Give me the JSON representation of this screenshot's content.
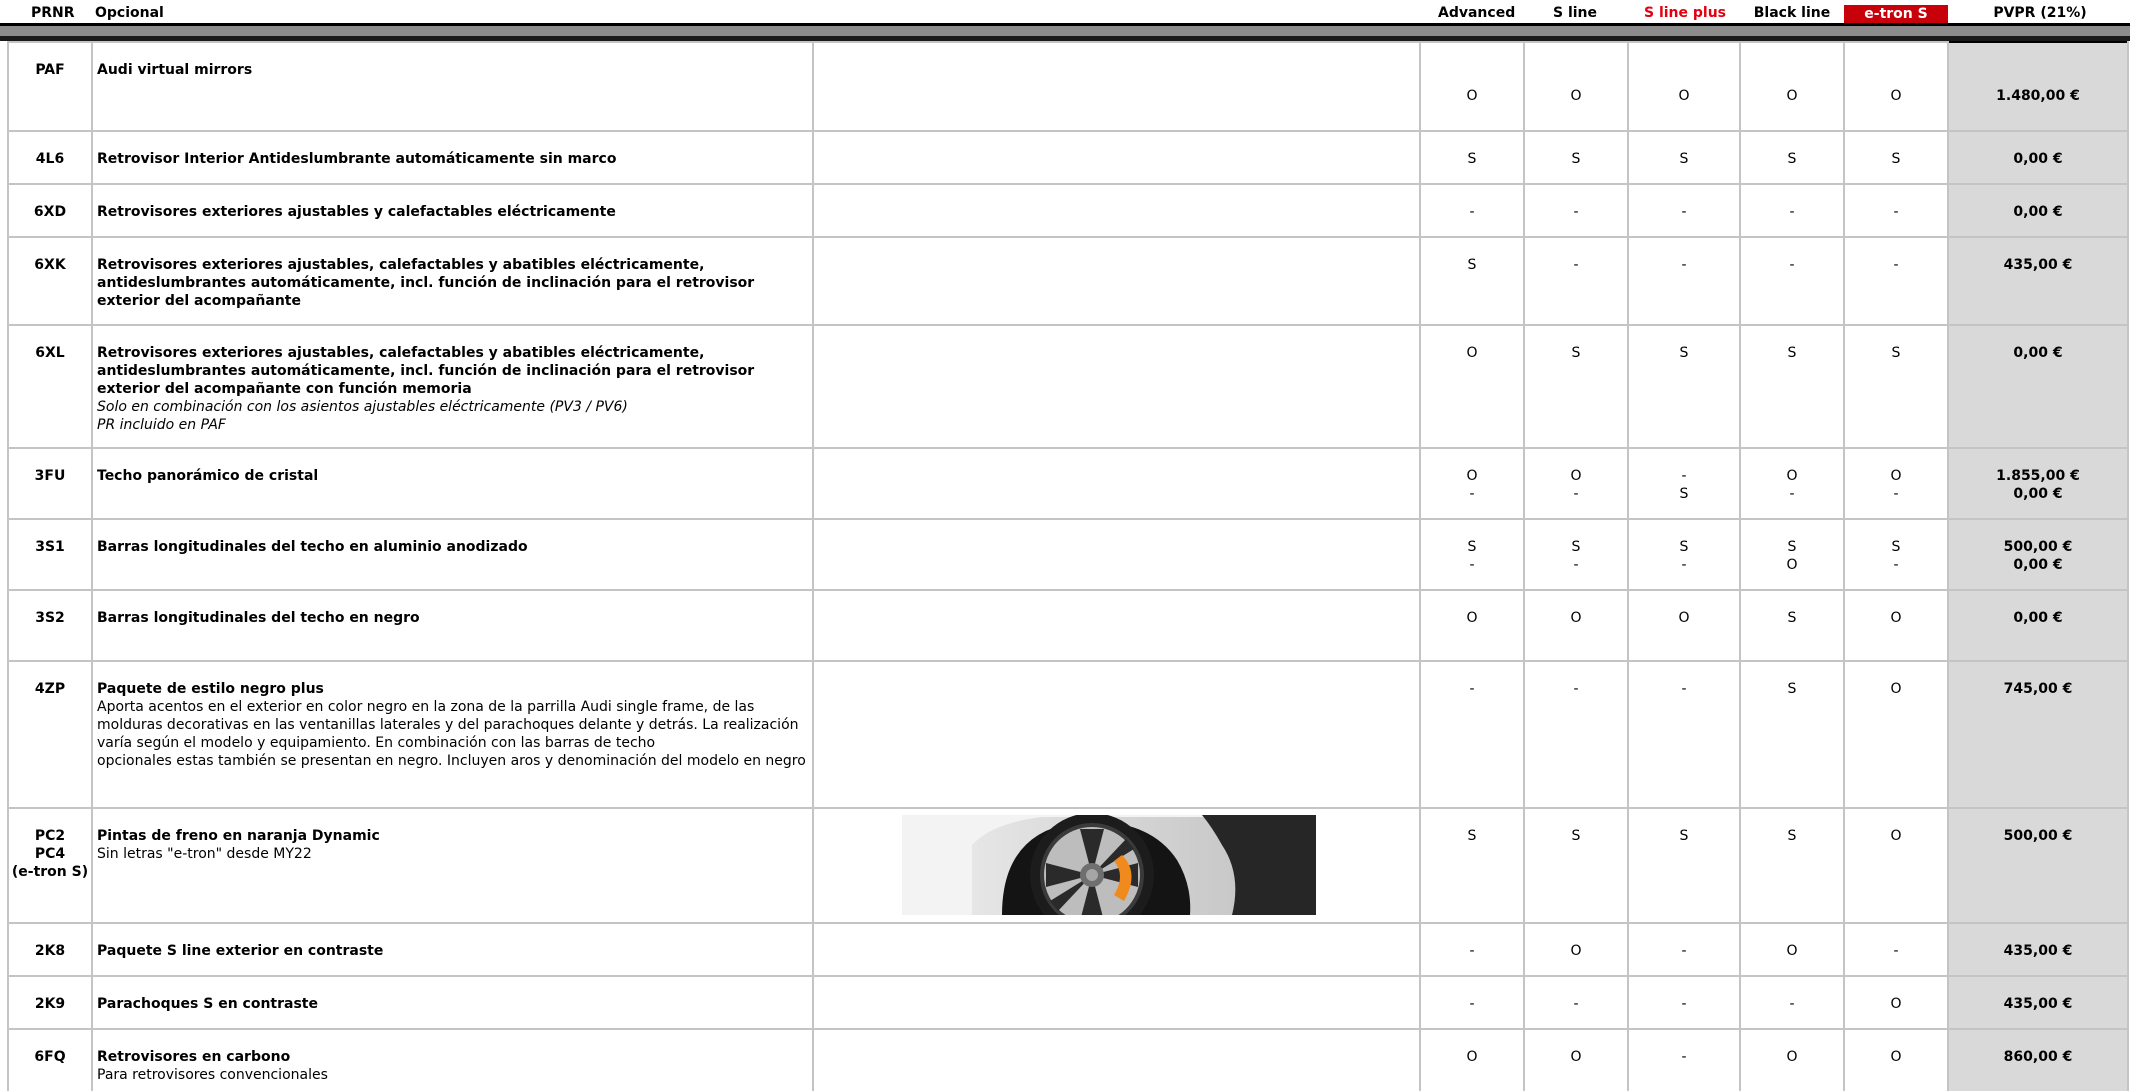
{
  "header": {
    "code": "PRNR",
    "option": "Opcional",
    "trims": [
      "Advanced",
      "S line",
      "S line plus",
      "Black line",
      "e-tron S"
    ],
    "price": "PVPR (21%)"
  },
  "colors": {
    "accent_red": "#e3000f",
    "etron_box": "#c8000a",
    "price_bg": "#d9d9d9"
  },
  "rows": [
    {
      "code": "PAF",
      "title": "Audi virtual mirrors",
      "sub": "",
      "note": "",
      "marks": [
        "O",
        "O",
        "O",
        "O",
        "O"
      ],
      "price": "1.480,00 €",
      "valign": "mid"
    },
    {
      "code": "4L6",
      "title": "Retrovisor Interior Antideslumbrante automáticamente sin marco",
      "sub": "",
      "note": "",
      "marks": [
        "S",
        "S",
        "S",
        "S",
        "S"
      ],
      "price": "0,00 €"
    },
    {
      "code": "6XD",
      "title": "Retrovisores exteriores ajustables y calefactables eléctricamente",
      "sub": "",
      "note": "",
      "marks": [
        "-",
        "-",
        "-",
        "-",
        "-"
      ],
      "price": "0,00 €"
    },
    {
      "code": "6XK",
      "title": "Retrovisores exteriores ajustables, calefactables y abatibles eléctricamente, antideslumbrantes automáticamente, incl. función de inclinación para el retrovisor exterior del acompañante",
      "sub": "",
      "note": "",
      "marks": [
        "S",
        "-",
        "-",
        "-",
        "-"
      ],
      "price": "435,00 €"
    },
    {
      "code": "6XL",
      "title": "Retrovisores exteriores ajustables, calefactables y abatibles eléctricamente, antideslumbrantes automáticamente, incl. función de inclinación para el retrovisor exterior del acompañante con función memoria",
      "sub": "",
      "note": "Solo en combinación con los asientos ajustables eléctricamente (PV3 / PV6)\nPR incluido en PAF",
      "marks": [
        "O",
        "S",
        "S",
        "S",
        "S"
      ],
      "price": "0,00 €"
    },
    {
      "code": "3FU",
      "title": "Techo panorámico de cristal",
      "sub": "",
      "note": "",
      "marks": [
        "O\n-",
        "O\n-",
        "-\nS",
        "O\n-",
        "O\n-"
      ],
      "price": "1.855,00 €\n0,00 €"
    },
    {
      "code": "3S1",
      "title": "Barras longitudinales del techo en aluminio anodizado",
      "sub": "",
      "note": "",
      "marks": [
        "S\n-",
        "S\n-",
        "S\n-",
        "S\nO",
        "S\n-"
      ],
      "price": "500,00 €\n0,00 €"
    },
    {
      "code": "3S2",
      "title": "Barras longitudinales del techo en negro",
      "sub": "",
      "note": "",
      "marks": [
        "O",
        "O",
        "O",
        "S",
        "O"
      ],
      "price": "0,00 €"
    },
    {
      "code": "4ZP",
      "title": "Paquete de estilo negro plus",
      "sub": "Aporta acentos en el exterior en color negro en la zona de la parrilla Audi single frame, de las molduras decorativas en las ventanillas laterales y del parachoques delante y detrás. La realización varía según el modelo y equipamiento. En combinación con las barras de techo\nopcionales estas también se presentan en negro. Incluyen aros y denominación del modelo en negro",
      "note": "",
      "marks": [
        "-",
        "-",
        "-",
        "S",
        "O"
      ],
      "price": "745,00 €"
    },
    {
      "code": "PC2\nPC4\n(e-tron S)",
      "title": "Pintas de freno en naranja Dynamic",
      "sub": "Sin letras \"e-tron\" desde MY22",
      "note": "",
      "marks": [
        "S",
        "S",
        "S",
        "S",
        "O"
      ],
      "price": "500,00 €"
    },
    {
      "code": "2K8",
      "title": "Paquete S line exterior en contraste",
      "sub": "",
      "note": "",
      "marks": [
        "-",
        "O",
        "-",
        "O",
        "-"
      ],
      "price": "435,00 €"
    },
    {
      "code": "2K9",
      "title": "Parachoques S en contraste",
      "sub": "",
      "note": "",
      "marks": [
        "-",
        "-",
        "-",
        "-",
        "O"
      ],
      "price": "435,00 €"
    },
    {
      "code": "6FQ",
      "title": "Retrovisores en carbono",
      "sub": "Para retrovisores convencionales",
      "note": "",
      "marks": [
        "O",
        "O",
        "-",
        "O",
        "O"
      ],
      "price": "860,00 €"
    }
  ]
}
